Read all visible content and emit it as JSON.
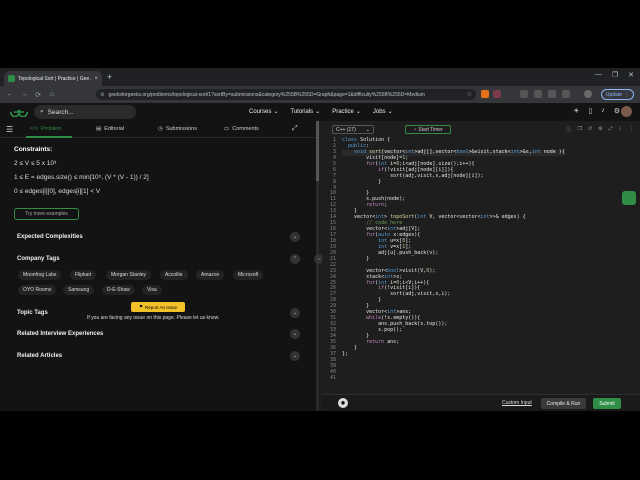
{
  "browser": {
    "tab_title": "Topological Sort | Practice | Gee…",
    "tab_close": "×",
    "new_tab": "+",
    "url": "geeksforgeeks.org/problems/topological-sort/1?sortBy=submissions&category%255B%255D=Graph&page=1&difficulty%255B%255D=Medium",
    "update_label": "Update",
    "window_controls": [
      "—",
      "❐",
      "✕"
    ]
  },
  "site": {
    "search_placeholder": "Search...",
    "nav": [
      "Courses",
      "Tutorials",
      "Practice",
      "Jobs"
    ]
  },
  "left": {
    "tabs": [
      "Problem",
      "Editorial",
      "Submissions",
      "Comments"
    ],
    "constraints_title": "Constraints:",
    "constraints": [
      "2 ≤ V ≤ 5 x 10³",
      "1 ≤ E = edges.size() ≤ min[10⁵, (V * (V - 1)) / 2]",
      "0 ≤ edges[i][0], edges[i][1] < V"
    ],
    "try_examples": "Try more examples",
    "sections": {
      "complexities": "Expected Complexities",
      "company_tags": "Company Tags",
      "topic_tags": "Topic Tags",
      "related_interview": "Related Interview Experiences",
      "related_articles": "Related Articles"
    },
    "companies": [
      "Moonfrog Labs",
      "Flipkart",
      "Morgan Stanley",
      "Accolite",
      "Amazon",
      "Microsoft",
      "OYO Rooms",
      "Samsung",
      "D-E-Shaw",
      "Visa"
    ],
    "report_label": "Report An Issue",
    "report_note": "If you are facing any issue on this page. Please let us know."
  },
  "editor": {
    "language": "C++ (17)",
    "timer_label": "Start Timer",
    "line_numbers": [
      "1",
      "2",
      "3",
      "4",
      "5",
      "6",
      "7",
      "8",
      "9",
      "10",
      "11",
      "12",
      "13",
      "14",
      "15",
      "16",
      "17",
      "18",
      "19",
      "20",
      "21",
      "22",
      "23",
      "24",
      "25",
      "26",
      "27",
      "28",
      "29",
      "30",
      "31",
      "32",
      "33",
      "34",
      "35",
      "36",
      "37",
      "38",
      "39",
      "40",
      "41"
    ],
    "custom_input": "Custom Input",
    "compile_run": "Compile & Run",
    "submit": "Submit"
  }
}
